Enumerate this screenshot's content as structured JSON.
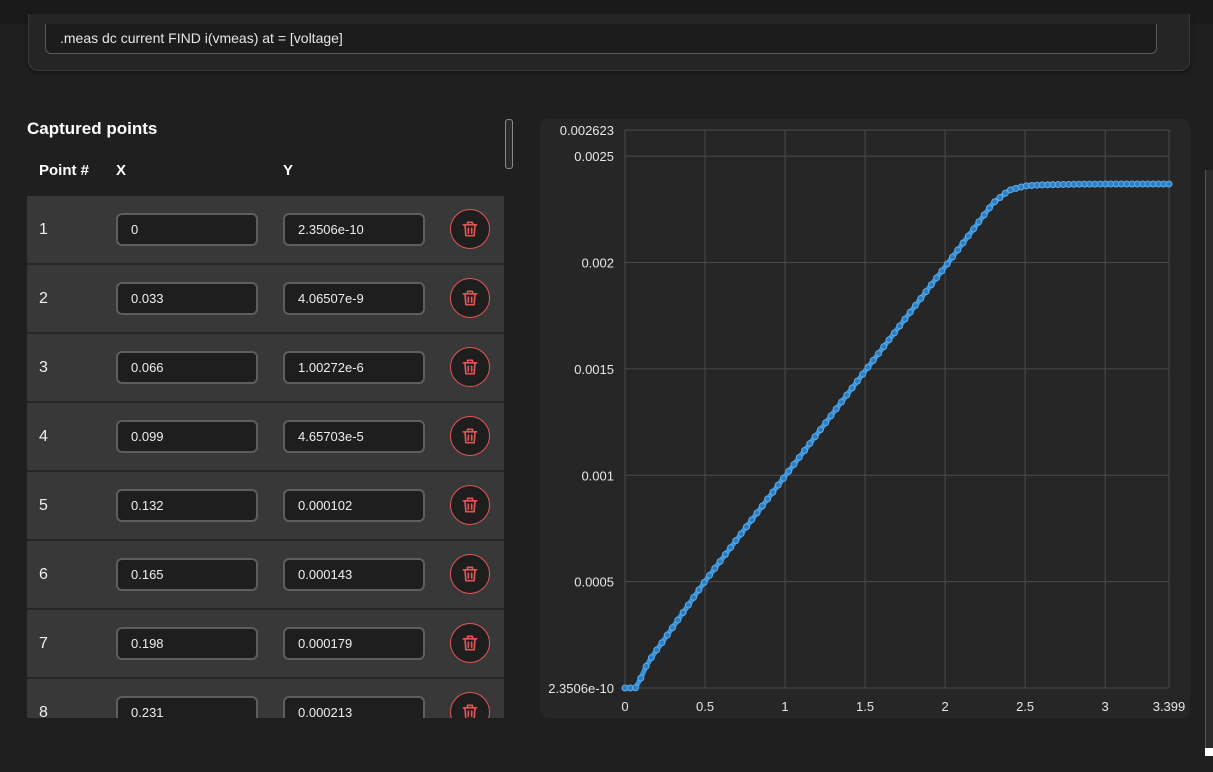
{
  "meas": {
    "command": ".meas dc current FIND i(vmeas) at = [voltage]"
  },
  "points": {
    "title": "Captured points",
    "headers": {
      "num": "Point #",
      "x": "X",
      "y": "Y"
    },
    "rows": [
      {
        "num": "1",
        "x": "0",
        "y": "2.3506e-10"
      },
      {
        "num": "2",
        "x": "0.033",
        "y": "4.06507e-9"
      },
      {
        "num": "3",
        "x": "0.066",
        "y": "1.00272e-6"
      },
      {
        "num": "4",
        "x": "0.099",
        "y": "4.65703e-5"
      },
      {
        "num": "5",
        "x": "0.132",
        "y": "0.000102"
      },
      {
        "num": "6",
        "x": "0.165",
        "y": "0.000143"
      },
      {
        "num": "7",
        "x": "0.198",
        "y": "0.000179"
      },
      {
        "num": "8",
        "x": "0.231",
        "y": "0.000213"
      }
    ]
  },
  "icons": {
    "delete": "trash-icon"
  },
  "colors": {
    "series": "#3a93d8",
    "delete": "#e05656",
    "grid": "#4a4a4a"
  },
  "chart_data": {
    "type": "line",
    "title": "",
    "xlabel": "",
    "ylabel": "",
    "xlim": [
      0,
      3.399
    ],
    "ylim": [
      2.3506e-10,
      0.002623
    ],
    "x_ticks": [
      "0",
      "0.5",
      "1",
      "1.5",
      "2",
      "2.5",
      "3",
      "3.399"
    ],
    "x_tick_values": [
      0,
      0.5,
      1,
      1.5,
      2,
      2.5,
      3,
      3.399
    ],
    "y_ticks": [
      "2.3506e-10",
      "0.0005",
      "0.001",
      "0.0015",
      "0.002",
      "0.0025",
      "0.002623"
    ],
    "y_tick_values": [
      2.3506e-10,
      0.0005,
      0.001,
      0.0015,
      0.002,
      0.0025,
      0.002623
    ],
    "grid": true,
    "series": [
      {
        "x": [
          0,
          0.033,
          0.066,
          0.099,
          0.132,
          0.165,
          0.198,
          0.231,
          0.5,
          1,
          1.5,
          2,
          2.2,
          2.3,
          2.4,
          2.5,
          2.6,
          2.8,
          3,
          3.2,
          3.399
        ],
        "y": [
          2.3506e-10,
          4.06507e-09,
          1.00272e-06,
          4.65703e-05,
          0.000102,
          0.000143,
          0.000179,
          0.000213,
          0.000502,
          0.000996,
          0.00149,
          0.00198,
          0.00218,
          0.00228,
          0.00234,
          0.00236,
          0.002365,
          0.002368,
          0.002369,
          0.002369,
          0.002369
        ]
      }
    ]
  }
}
